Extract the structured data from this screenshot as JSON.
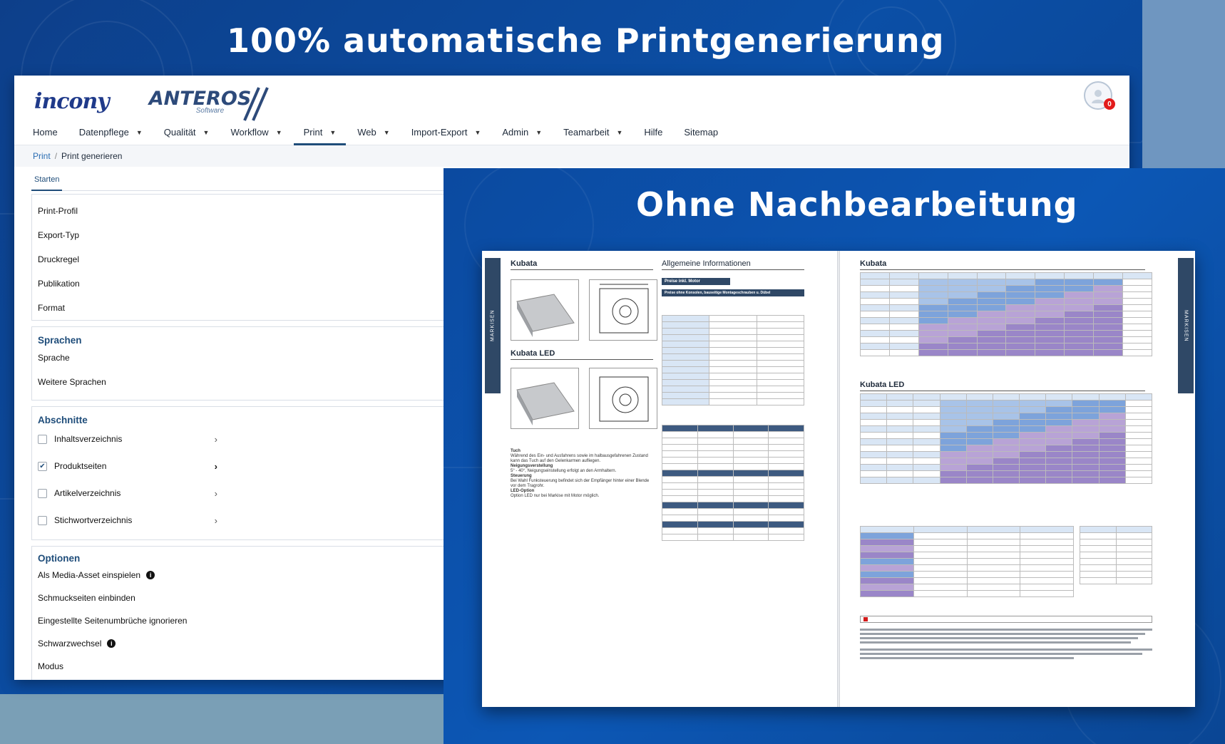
{
  "headlines": {
    "top": "100% automatische Printgenerierung",
    "middle": "Ohne Nachbearbeitung"
  },
  "logos": {
    "incony": "incony",
    "anteros_main": "ANTEROS",
    "anteros_sub": "Software"
  },
  "user": {
    "notification_count": "0"
  },
  "nav": {
    "items": [
      {
        "label": "Home",
        "dropdown": false
      },
      {
        "label": "Datenpflege",
        "dropdown": true
      },
      {
        "label": "Qualität",
        "dropdown": true
      },
      {
        "label": "Workflow",
        "dropdown": true
      },
      {
        "label": "Print",
        "dropdown": true,
        "active": true
      },
      {
        "label": "Web",
        "dropdown": true
      },
      {
        "label": "Import-Export",
        "dropdown": true
      },
      {
        "label": "Admin",
        "dropdown": true
      },
      {
        "label": "Teamarbeit",
        "dropdown": true
      },
      {
        "label": "Hilfe",
        "dropdown": false
      },
      {
        "label": "Sitemap",
        "dropdown": false
      }
    ]
  },
  "breadcrumb": {
    "parent": "Print",
    "separator": "/",
    "current": "Print generieren"
  },
  "tabs": {
    "start": "Starten"
  },
  "settings": {
    "fields": [
      "Print-Profil",
      "Export-Typ",
      "Druckregel",
      "Publikation",
      "Format"
    ]
  },
  "sprachen": {
    "title": "Sprachen",
    "fields": [
      "Sprache",
      "Weitere Sprachen"
    ]
  },
  "abschnitte": {
    "title": "Abschnitte",
    "items": [
      {
        "label": "Inhaltsverzeichnis",
        "checked": false
      },
      {
        "label": "Produktseiten",
        "checked": true
      },
      {
        "label": "Artikelverzeichnis",
        "checked": false
      },
      {
        "label": "Stichwortverzeichnis",
        "checked": false
      }
    ]
  },
  "optionen": {
    "title": "Optionen",
    "items": [
      {
        "label": "Als Media-Asset einspielen",
        "info": true
      },
      {
        "label": "Schmuckseiten einbinden",
        "info": false
      },
      {
        "label": "Eingestellte Seitenumbrüche ignorieren",
        "info": false
      },
      {
        "label": "Schwarzwechsel",
        "info": true
      },
      {
        "label": "Modus",
        "info": false
      }
    ]
  },
  "brochure": {
    "side_tab": "MARKISEN",
    "left_page": {
      "product_1": "Kubata",
      "product_2": "Kubata LED",
      "info_title": "Allgemeine Informationen",
      "price_tag_1": "Preise inkl. Motor",
      "price_tag_2": "Preise ohne Konsolen, bauseitige Montageschrauben u. Dübel",
      "body_heading_1": "Tuch",
      "body_text_1": "Während des Ein- und Ausfahrens sowie im halbausgefahrenen Zustand kann das Tuch auf den Gelenkarmen aufliegen.",
      "body_heading_2": "Neigungsverstellung",
      "body_text_2": "5° - 40°, Neigungseinstellung erfolgt an den Armhaltern.",
      "body_heading_3": "Steuerung",
      "body_text_3": "Bei Wahl Funksteuerung befindet sich der Empfänger hinter einer Blende vor dem Tragrohr.",
      "body_heading_4": "LED-Option",
      "body_text_4": "Option LED nur bei Markise mit Motor möglich."
    },
    "right_page": {
      "product_1": "Kubata",
      "product_2": "Kubata LED"
    }
  },
  "colors": {
    "brand_blue": "#1f4d7a",
    "link_blue": "#2a6db3",
    "badge_red": "#e21b1b"
  }
}
